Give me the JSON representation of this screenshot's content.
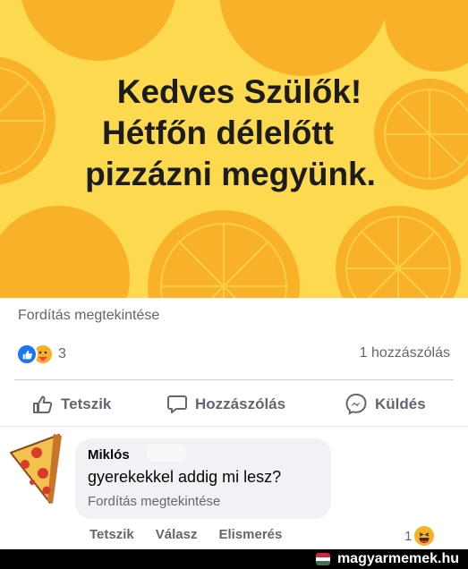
{
  "banner": {
    "line1": "Kedves Szülők!",
    "line2": "Hétfőn délelőtt",
    "line3": "pizzázni megyünk.",
    "background_color": "#fcd94e",
    "orange_color": "#f9b12a"
  },
  "post": {
    "translate_label": "Fordítás megtekintése",
    "reactions_count": "3",
    "reaction_icons": [
      "like-icon",
      "care-icon"
    ],
    "comments_count_label": "1 hozzászólás"
  },
  "actions": {
    "like_label": "Tetszik",
    "comment_label": "Hozzászólás",
    "send_label": "Küldés"
  },
  "comment": {
    "author": "Miklós",
    "text": "gyerekekkel addig mi lesz?",
    "translate_label": "Fordítás megtekintése",
    "actions": {
      "like_label": "Tetszik",
      "reply_label": "Válasz",
      "acknowledge_label": "Elismerés"
    },
    "reaction_count": "1",
    "reaction_icon": "haha-icon"
  },
  "watermark": {
    "text": "magyarmemek.hu"
  },
  "colors": {
    "facebook_blue": "#1877f2",
    "secondary_text": "#606770"
  }
}
